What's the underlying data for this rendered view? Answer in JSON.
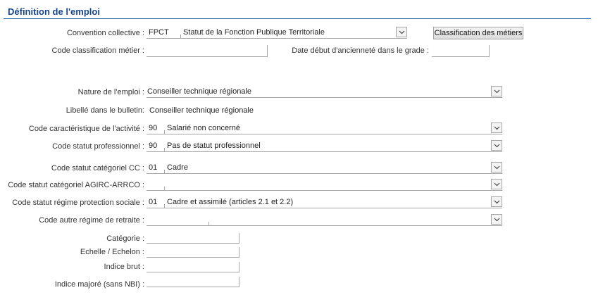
{
  "section": {
    "title": "Définition de l'emploi"
  },
  "convention": {
    "label": "Convention collective :",
    "code": "FPCT",
    "text": "Statut de la Fonction Publique Territoriale",
    "button": "Classification des métiers"
  },
  "code_classification": {
    "label": "Code classification métier :",
    "value": ""
  },
  "date_anciennete": {
    "label": "Date début d'ancienneté dans le grade :",
    "value": ""
  },
  "nature_emploi": {
    "label": "Nature de l'emploi :",
    "text": "Conseiller technique régionale"
  },
  "libelle_bulletin": {
    "label": "Libellé dans le bulletin:",
    "value": "Conseiller technique régionale"
  },
  "code_activite": {
    "label": "Code caractéristique de l'activité :",
    "code": "90",
    "text": "Salarié non concerné"
  },
  "code_statut_pro": {
    "label": "Code statut professionnel :",
    "code": "90",
    "text": "Pas de statut professionnel"
  },
  "code_statut_cc": {
    "label": "Code statut catégoriel CC :",
    "code": "01",
    "text": "Cadre"
  },
  "code_agirc": {
    "label": "Code statut catégoriel AGIRC-ARRCO :",
    "code": "",
    "text": ""
  },
  "code_protection": {
    "label": "Code statut régime protection sociale :",
    "code": "01",
    "text": "Cadre et assimilé (articles 2.1 et 2.2)"
  },
  "code_autre_regime": {
    "label": "Code autre régime de retraite :",
    "code": "",
    "text": ""
  },
  "categorie": {
    "label": "Catégorie :",
    "value": ""
  },
  "echelle": {
    "label": "Echelle / Echelon :",
    "value": ""
  },
  "indice_brut": {
    "label": "Indice brut :",
    "value": ""
  },
  "indice_majore": {
    "label": "Indice majoré (sans NBI) :",
    "value": ""
  }
}
